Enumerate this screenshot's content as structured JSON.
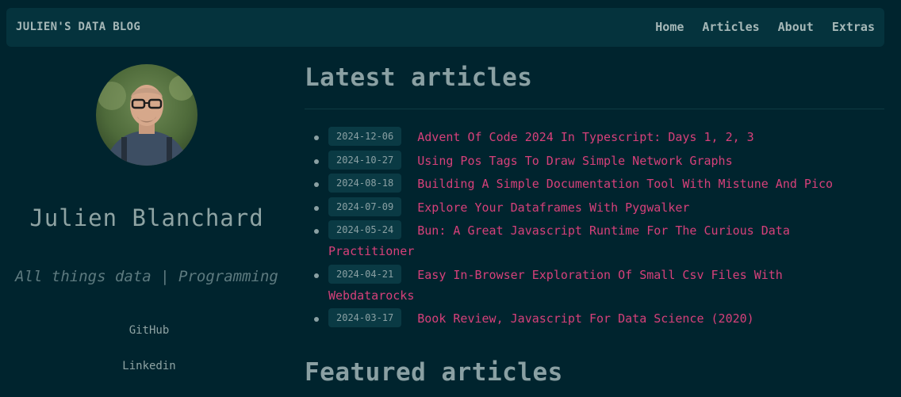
{
  "brand": "JULIEN'S DATA BLOG",
  "nav": [
    "Home",
    "Articles",
    "About",
    "Extras"
  ],
  "author": {
    "name": "Julien Blanchard",
    "tagline": "All things data | Programming"
  },
  "social": [
    "GitHub",
    "Linkedin"
  ],
  "latest": {
    "title": "Latest articles",
    "articles": [
      {
        "date": "2024-12-06",
        "title": "Advent Of Code 2024 In Typescript: Days 1, 2, 3"
      },
      {
        "date": "2024-10-27",
        "title": "Using Pos Tags To Draw Simple Network Graphs"
      },
      {
        "date": "2024-08-18",
        "title": "Building A Simple Documentation Tool With Mistune And Pico"
      },
      {
        "date": "2024-07-09",
        "title": "Explore Your Dataframes With Pygwalker"
      },
      {
        "date": "2024-05-24",
        "title": "Bun: A Great Javascript Runtime For The Curious Data Practitioner"
      },
      {
        "date": "2024-04-21",
        "title": "Easy In-Browser Exploration Of Small Csv Files With Webdatarocks"
      },
      {
        "date": "2024-03-17",
        "title": "Book Review, Javascript For Data Science (2020)"
      }
    ]
  },
  "featured": {
    "title": "Featured articles"
  }
}
